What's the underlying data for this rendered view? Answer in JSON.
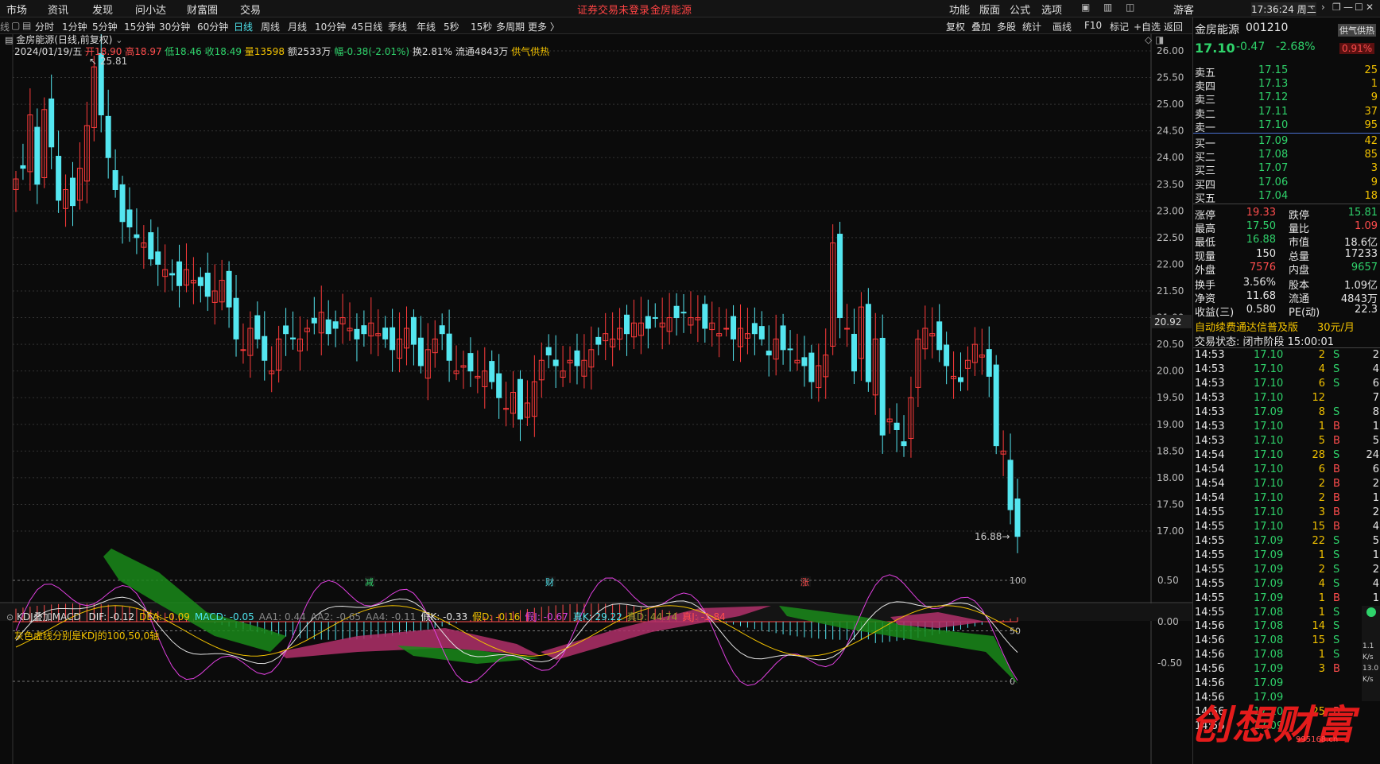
{
  "menubar": {
    "left": [
      "市场",
      "资讯",
      "发现",
      "问小达",
      "财富圈",
      "交易"
    ],
    "notice": "证券交易未登录",
    "stock_name_top": "金房能源",
    "right": [
      "功能",
      "版面",
      "公式",
      "选项"
    ],
    "user": "游客",
    "clock": "17:36:24 周二",
    "colors": {
      "notice": "#ff4444"
    }
  },
  "toolbar": {
    "left_stub": "线",
    "periods": [
      "分时",
      "1分钟",
      "5分钟",
      "15分钟",
      "30分钟",
      "60分钟",
      "日线",
      "周线",
      "月线",
      "10分钟",
      "45日线",
      "季线",
      "年线",
      "5秒",
      "15秒",
      "多周期",
      "更多 〉"
    ],
    "active_period": "日线",
    "right": [
      "复权",
      "叠加",
      "多股",
      "统计",
      "画线",
      "F10",
      "标记",
      "+自选",
      "返回"
    ]
  },
  "main_chart": {
    "title": "金房能源(日线,前复权)",
    "date": "2024/01/19/五",
    "open": "开18.90",
    "high": "高18.97",
    "low": "低18.46",
    "close": "收18.49",
    "volume": "量13598",
    "amount": "额2533万",
    "change": "幅-0.38(-2.01%)",
    "turnover": "换2.81%",
    "float": "流通4843万",
    "tag": "供气供热",
    "max_label": "25.81",
    "min_label": "16.88",
    "price_marker": "20.92",
    "y_ticks": [
      "26.00",
      "25.50",
      "25.00",
      "24.50",
      "24.00",
      "23.50",
      "23.00",
      "22.50",
      "22.00",
      "21.50",
      "21.00",
      "20.50",
      "20.00",
      "19.50",
      "19.00",
      "18.50",
      "18.00",
      "17.50",
      "17.00"
    ],
    "events": [
      "减",
      "财",
      "涨"
    ],
    "colors": {
      "up": "#ff3b3b",
      "down": "#54e6f0",
      "grid": "#333333",
      "bg": "#0b0b0b"
    }
  },
  "indicator": {
    "name": "KDJ叠加MACD",
    "values": [
      {
        "t": "DIF: -0.12",
        "c": "#e6e6e6"
      },
      {
        "t": "DEA: -0.09",
        "c": "#f2c200"
      },
      {
        "t": "MACD: -0.05",
        "c": "#4ee4ee"
      },
      {
        "t": "AA1: 0.44",
        "c": "#888888"
      },
      {
        "t": "AA2: -0.65",
        "c": "#888888"
      },
      {
        "t": "AA4: -0.11",
        "c": "#888888"
      },
      {
        "t": "假K: -0.33",
        "c": "#e6e6e6"
      },
      {
        "t": "假D: -0.16",
        "c": "#f2c200"
      },
      {
        "t": "假J: -0.67",
        "c": "#e040e0"
      },
      {
        "t": "真K: 29.22",
        "c": "#4ee4ee"
      },
      {
        "t": "真D: 44.74",
        "c": "#9a9a30"
      },
      {
        "t": "真J: -1.84",
        "c": "#ff4d4d"
      }
    ],
    "note": "灰色虚线分别是KDJ的100,50,0轴",
    "y_ticks": [
      "0.50",
      "0.00",
      "-0.50"
    ],
    "kdj_ticks": [
      "100",
      "50",
      "0"
    ]
  },
  "quote": {
    "name": "金房能源",
    "code": "001210",
    "tag": "供气供热",
    "price": "17.10",
    "change": "-0.47",
    "pct": "-2.68%",
    "ratio": "0.91%",
    "asks": [
      {
        "label": "卖五",
        "price": "17.15",
        "vol": "25"
      },
      {
        "label": "卖四",
        "price": "17.13",
        "vol": "1"
      },
      {
        "label": "卖三",
        "price": "17.12",
        "vol": "9"
      },
      {
        "label": "卖二",
        "price": "17.11",
        "vol": "37"
      },
      {
        "label": "卖一",
        "price": "17.10",
        "vol": "95"
      }
    ],
    "bids": [
      {
        "label": "买一",
        "price": "17.09",
        "vol": "42"
      },
      {
        "label": "买二",
        "price": "17.08",
        "vol": "85"
      },
      {
        "label": "买三",
        "price": "17.07",
        "vol": "3"
      },
      {
        "label": "买四",
        "price": "17.06",
        "vol": "9"
      },
      {
        "label": "买五",
        "price": "17.04",
        "vol": "18"
      }
    ],
    "stats": [
      {
        "l1": "涨停",
        "v1": "19.33",
        "c1": "red",
        "l2": "跌停",
        "v2": "15.81",
        "c2": "grn"
      },
      {
        "l1": "最高",
        "v1": "17.50",
        "c1": "grn",
        "l2": "量比",
        "v2": "1.09",
        "c2": "red"
      },
      {
        "l1": "最低",
        "v1": "16.88",
        "c1": "grn",
        "l2": "市值",
        "v2": "18.6亿",
        "c2": "wht"
      },
      {
        "l1": "现量",
        "v1": "150",
        "c1": "wht",
        "l2": "总量",
        "v2": "17233",
        "c2": "wht"
      },
      {
        "l1": "外盘",
        "v1": "7576",
        "c1": "red",
        "l2": "内盘",
        "v2": "9657",
        "c2": "grn"
      },
      {
        "l1": "换手",
        "v1": "3.56%",
        "c1": "wht",
        "l2": "股本",
        "v2": "1.09亿",
        "c2": "wht"
      },
      {
        "l1": "净资",
        "v1": "11.68",
        "c1": "wht",
        "l2": "流通",
        "v2": "4843万",
        "c2": "wht"
      },
      {
        "l1": "收益(三)",
        "v1": "0.580",
        "c1": "wht",
        "l2": "PE(动)",
        "v2": "22.3",
        "c2": "wht"
      }
    ],
    "promo": "自动续费通达信普及版",
    "promo_price": "30元/月",
    "status": "交易状态: 闭市阶段 15:00:01",
    "ticks": [
      [
        "14:53",
        "17.10",
        "2",
        "S",
        "2"
      ],
      [
        "14:53",
        "17.10",
        "4",
        "S",
        "4"
      ],
      [
        "14:53",
        "17.10",
        "6",
        "S",
        "6"
      ],
      [
        "14:53",
        "17.10",
        "12",
        "",
        "7"
      ],
      [
        "14:53",
        "17.09",
        "8",
        "S",
        "8"
      ],
      [
        "14:53",
        "17.10",
        "1",
        "B",
        "1"
      ],
      [
        "14:53",
        "17.10",
        "5",
        "B",
        "5"
      ],
      [
        "14:54",
        "17.10",
        "28",
        "S",
        "24"
      ],
      [
        "14:54",
        "17.10",
        "6",
        "B",
        "6"
      ],
      [
        "14:54",
        "17.10",
        "2",
        "B",
        "2"
      ],
      [
        "14:54",
        "17.10",
        "2",
        "B",
        "1"
      ],
      [
        "14:55",
        "17.10",
        "3",
        "B",
        "2"
      ],
      [
        "14:55",
        "17.10",
        "15",
        "B",
        "4"
      ],
      [
        "14:55",
        "17.09",
        "22",
        "S",
        "5"
      ],
      [
        "14:55",
        "17.09",
        "1",
        "S",
        "1"
      ],
      [
        "14:55",
        "17.09",
        "2",
        "S",
        "2"
      ],
      [
        "14:55",
        "17.09",
        "4",
        "S",
        "4"
      ],
      [
        "14:55",
        "17.09",
        "1",
        "B",
        "1"
      ],
      [
        "14:55",
        "17.08",
        "1",
        "S",
        "1"
      ],
      [
        "14:56",
        "17.08",
        "14",
        "S",
        "3"
      ],
      [
        "14:56",
        "17.08",
        "15",
        "S",
        "5"
      ],
      [
        "14:56",
        "17.08",
        "1",
        "S",
        "1"
      ],
      [
        "14:56",
        "17.09",
        "3",
        "B",
        "2"
      ],
      [
        "14:56",
        "17.09",
        "",
        "",
        ""
      ],
      [
        "14:56",
        "17.09",
        "",
        "",
        ""
      ],
      [
        "14:56",
        "17.10",
        "25",
        "B",
        ""
      ],
      [
        "14:56",
        "17.09",
        "",
        "",
        ""
      ]
    ],
    "watermark": "创想财富",
    "watermark_url": "995168.cn",
    "mini": [
      "1.1",
      "K/s",
      "13.0",
      "K/s"
    ]
  }
}
